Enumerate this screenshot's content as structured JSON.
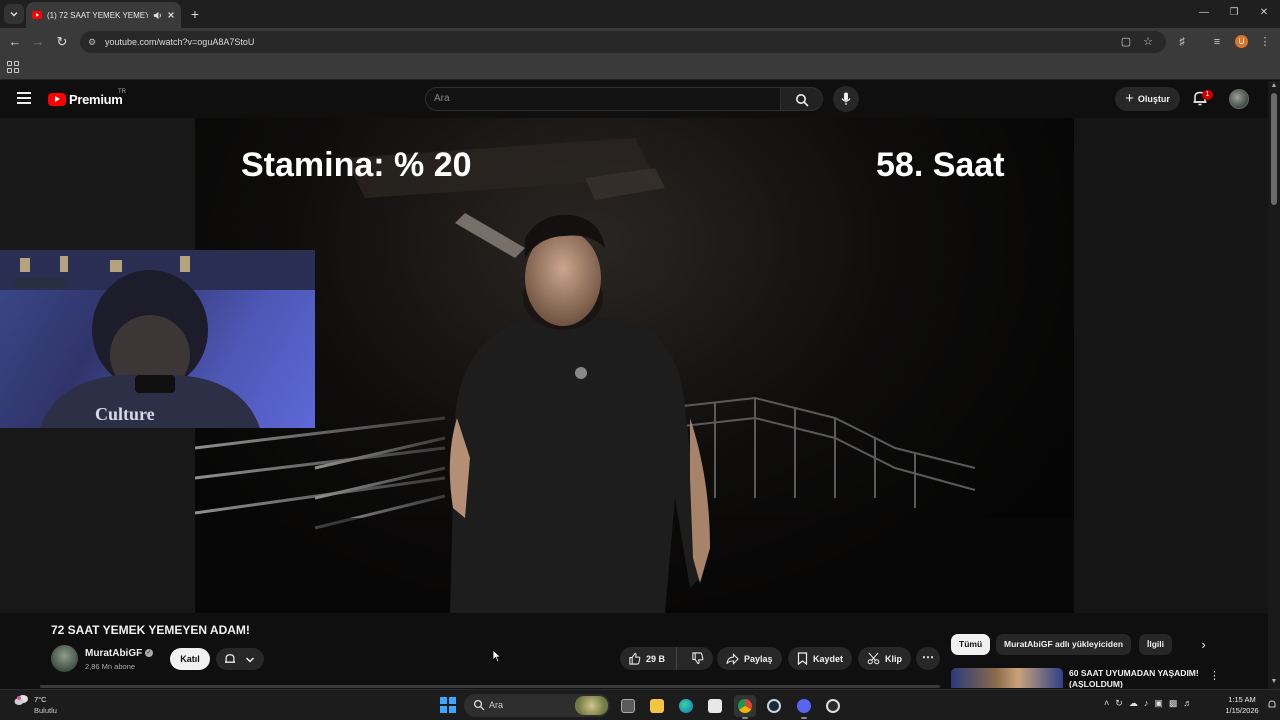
{
  "browser": {
    "tab_title": "(1) 72 SAAT YEMEK YEMEY...",
    "url": "youtube.com/watch?v=oguA8A7StoU",
    "profile_initial": "U"
  },
  "youtube": {
    "logo_text": "Premium",
    "logo_region": "TR",
    "search_placeholder": "Ara",
    "create_label": "Oluştur",
    "notification_count": "1"
  },
  "video": {
    "overlay_stamina": "Stamina: % 20",
    "overlay_hour": "58. Saat",
    "webcam_shirt_text": "Culture",
    "title": "72 SAAT YEMEK YEMEYEN ADAM!",
    "channel_name": "MuratAbiGF",
    "subscribers": "2,86 Mn abone",
    "join_label": "Katıl",
    "like_count": "29 B",
    "share_label": "Paylaş",
    "save_label": "Kaydet",
    "clip_label": "Klip"
  },
  "chips": [
    "Tümü",
    "MuratAbiGF adlı yükleyiciden",
    "İlgili"
  ],
  "recommendation": {
    "title": "60 SAAT UYUMADAN YAŞADIM! (AŞLOLDUM)"
  },
  "taskbar": {
    "weather_temp": "7°C",
    "weather_desc": "Bulutlu",
    "search_text": "Ara",
    "time": "1:15 AM",
    "date": "1/15/2026",
    "apps": [
      "task-view",
      "file-explorer",
      "edge",
      "store",
      "chrome",
      "steam",
      "discord",
      "clock-app"
    ]
  },
  "colors": {
    "accent_red": "#ff0000",
    "windows_blue": "#3da6ff"
  }
}
